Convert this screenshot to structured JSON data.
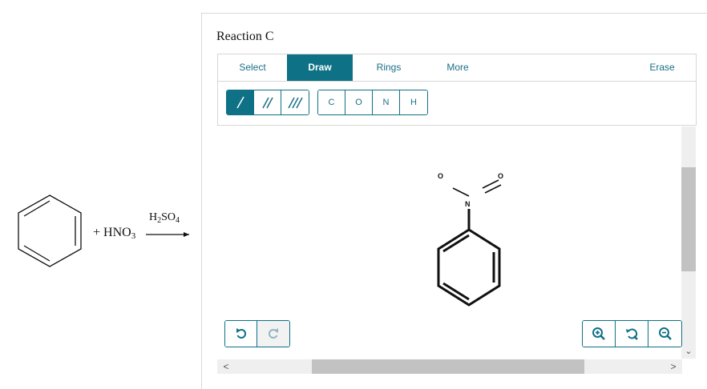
{
  "scheme": {
    "plus_reagent": "+ HNO",
    "reagent_sub": "3",
    "catalyst_h": "H",
    "catalyst_sub1": "2",
    "catalyst_so": "SO",
    "catalyst_sub2": "4"
  },
  "panel": {
    "title": "Reaction C",
    "tabs": {
      "select": "Select",
      "draw": "Draw",
      "rings": "Rings",
      "more": "More",
      "erase": "Erase"
    },
    "atoms": [
      "C",
      "O",
      "N",
      "H"
    ]
  },
  "molecule": {
    "n_label": "N",
    "o_left_label": "O",
    "o_right_label": "O"
  },
  "scrollbars": {
    "left_arrow": "<",
    "right_arrow": ">",
    "down_arrow": "⌄"
  },
  "colors": {
    "accent": "#0e7185",
    "bond": "#111111"
  }
}
